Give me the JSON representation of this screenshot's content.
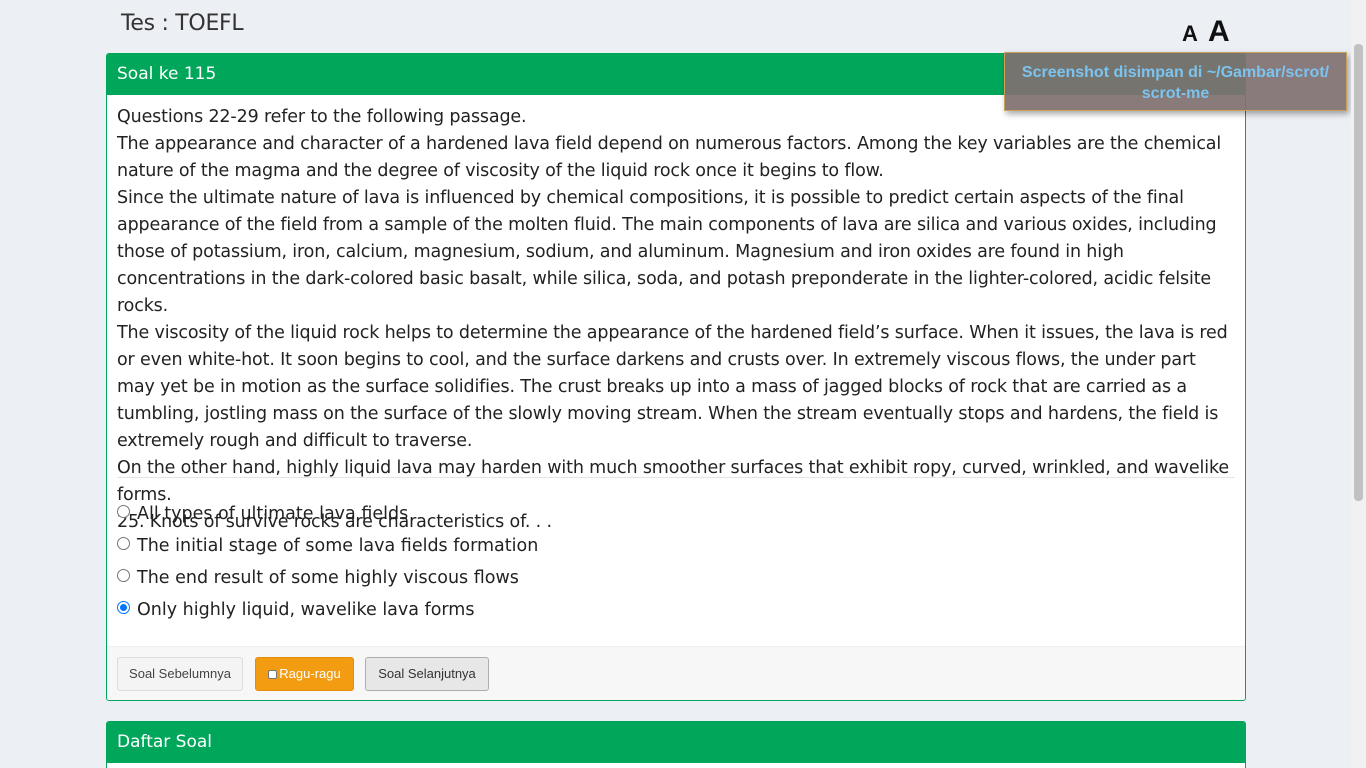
{
  "page": {
    "title": "Tes : TOEFL",
    "font_small": "A",
    "font_large": "A"
  },
  "question": {
    "header": "Soal ke 115",
    "passage": [
      "Questions 22-29 refer to the following passage.",
      "The appearance and character of a hardened lava field depend on numerous factors. Among the key variables are the chemical nature of the magma and the degree of viscosity of the liquid rock once it begins to flow.",
      "Since the ultimate nature of lava is influenced by chemical compositions, it is possible to predict certain aspects of the final appearance of the field from a sample of the molten fluid. The main components of lava are silica and various oxides, including those of potassium, iron, calcium, magnesium, sodium, and aluminum. Magnesium and iron oxides are found in high concentrations in the dark-colored basic basalt, while silica, soda, and potash preponderate in the lighter-colored, acidic felsite rocks.",
      "The viscosity of the liquid rock helps to determine the appearance of the hardened field’s surface. When it issues, the lava is red or even white-hot. It soon begins to cool, and the surface darkens and crusts over. In extremely viscous flows, the under part may yet be in motion as the surface solidifies. The crust breaks up into a mass of jagged blocks of rock that are carried as a tumbling, jostling mass on the surface of the slowly moving stream. When the stream eventually stops and hardens, the field is extremely rough and difficult to traverse.",
      "On the other hand, highly liquid lava may harden with much smoother surfaces that exhibit ropy, curved, wrinkled, and wavelike forms.",
      "25. Knots of survive rocks are characteristics of. . ."
    ],
    "options": [
      {
        "label": "All types of ultimate lava fields",
        "checked": false
      },
      {
        "label": "The initial stage of some lava fields formation",
        "checked": false
      },
      {
        "label": "The end result of some highly viscous flows",
        "checked": false
      },
      {
        "label": "Only highly liquid, wavelike lava forms",
        "checked": true
      }
    ],
    "buttons": {
      "prev": "Soal Sebelumnya",
      "doubt": "Ragu-ragu",
      "next": "Soal Selanjutnya"
    }
  },
  "list": {
    "header": "Daftar Soal"
  },
  "toast": {
    "line1": "Screenshot disimpan di ~/Gambar/scrot/",
    "line2": "scrot-me"
  },
  "colors": {
    "primary": "#00a65a",
    "warning": "#f39c12",
    "background": "#ecf0f5",
    "toast_text": "#7cc4f0"
  }
}
